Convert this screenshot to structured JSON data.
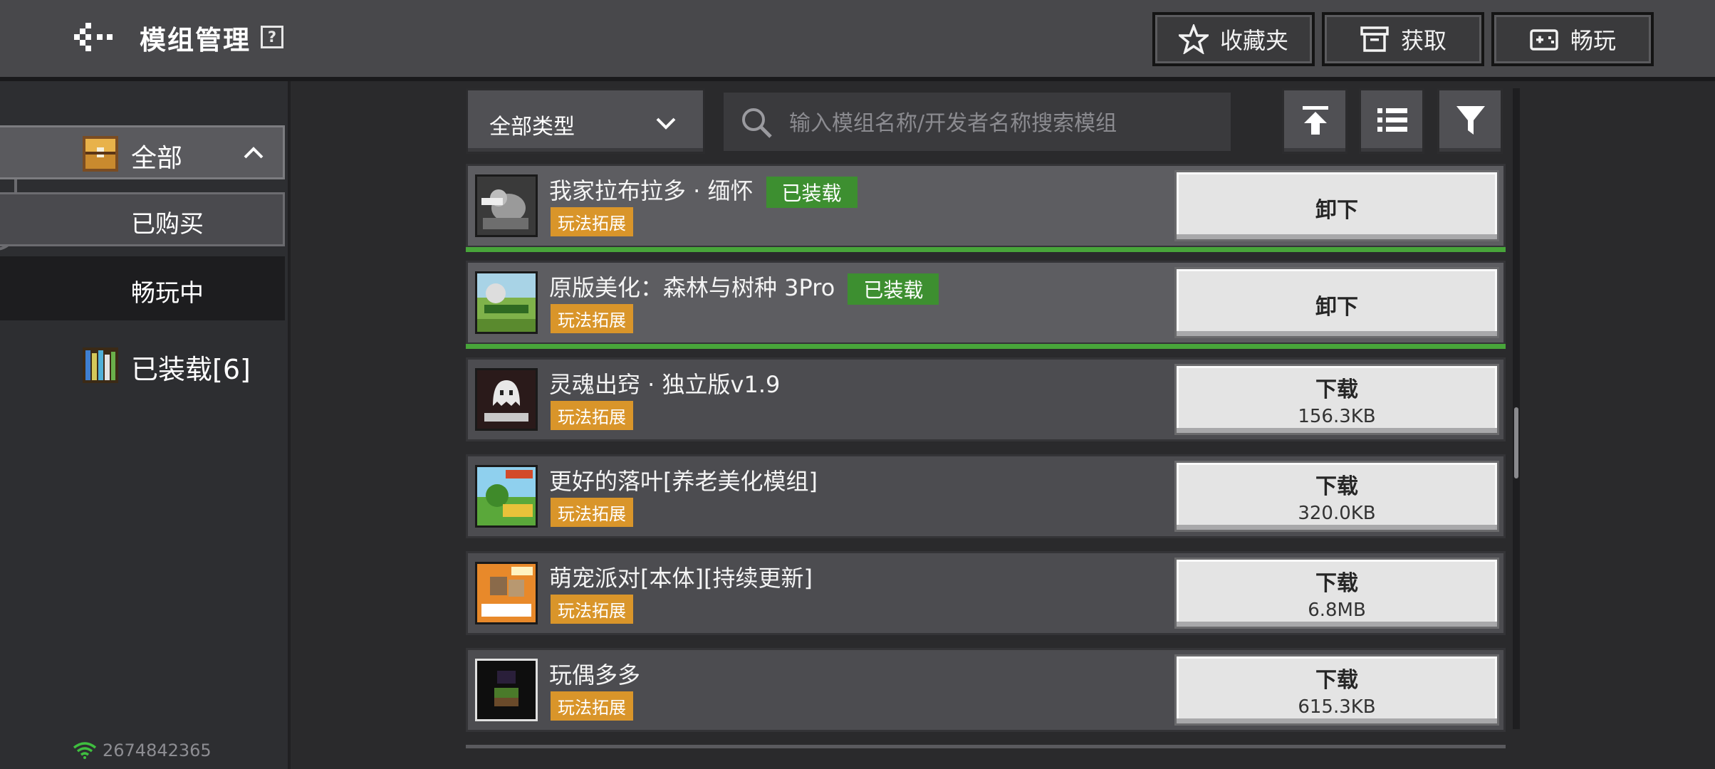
{
  "header": {
    "title": "模组管理",
    "help_glyph": "?",
    "buttons": {
      "favorites": "收藏夹",
      "get": "获取",
      "play": "畅玩"
    }
  },
  "sidebar": {
    "all": "全部",
    "bought": "已购买",
    "playing": "畅玩中",
    "installed": "已装载[6]",
    "uid": "2674842365"
  },
  "toolbar": {
    "type_select": "全部类型",
    "search_placeholder": "输入模组名称/开发者名称搜索模组"
  },
  "mods": [
    {
      "name": "我家拉布拉多 · 缅怀",
      "badge": "已装载",
      "tag": "玩法拓展",
      "action": "卸下",
      "size": ""
    },
    {
      "name": "原版美化：森林与树种 3Pro",
      "badge": "已装载",
      "tag": "玩法拓展",
      "action": "卸下",
      "size": ""
    },
    {
      "name": "灵魂出窍 · 独立版v1.9",
      "badge": "",
      "tag": "玩法拓展",
      "action": "下载",
      "size": "156.3KB"
    },
    {
      "name": "更好的落叶[养老美化模组]",
      "badge": "",
      "tag": "玩法拓展",
      "action": "下载",
      "size": "320.0KB"
    },
    {
      "name": "萌宠派对[本体][持续更新]",
      "badge": "",
      "tag": "玩法拓展",
      "action": "下载",
      "size": "6.8MB"
    },
    {
      "name": "玩偶多多",
      "badge": "",
      "tag": "玩法拓展",
      "action": "下载",
      "size": "615.3KB"
    }
  ],
  "colors": {
    "installed_green": "#48a53a",
    "tag_orange": "#d9952a",
    "badge_green": "#3d8f30"
  }
}
